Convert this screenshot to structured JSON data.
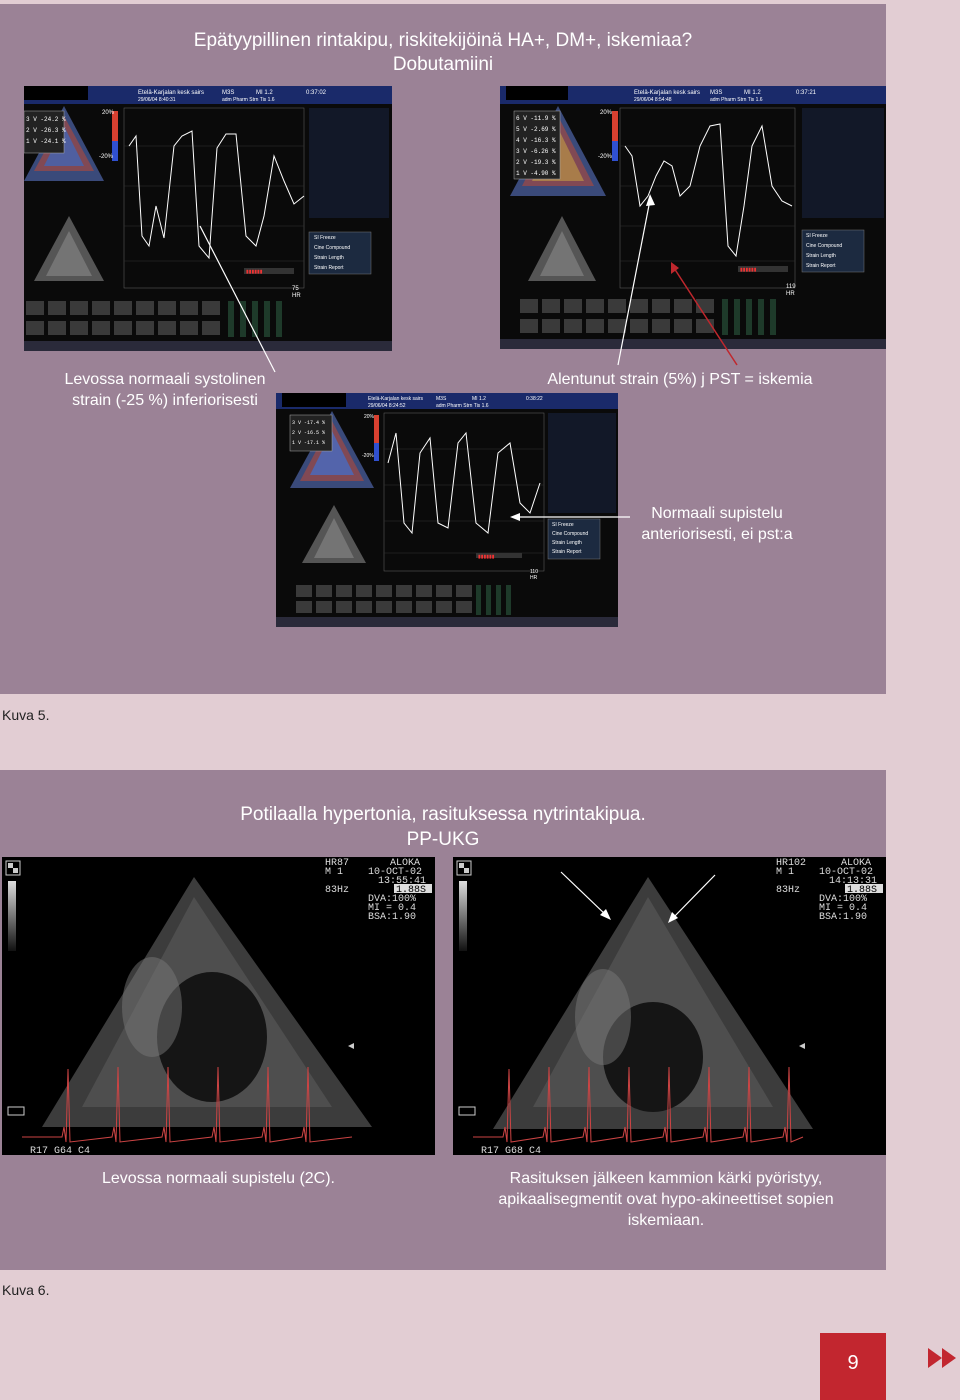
{
  "figure5": {
    "title_line1": "Epätyypillinen rintakipu, riskitekijöinä HA+, DM+, iskemiaa?",
    "title_line2": "Dobutamiini",
    "screen1": {
      "hospital": "Etelä-Karjalan kesk sairs",
      "date": "29/06/04 8:40:31",
      "app": "adm Pharm Strn Tis 1.6",
      "time": "0:37:02",
      "probe": "M3S",
      "mi": "MI 1.2",
      "plus_pct": "20%",
      "minus_pct": "-20%",
      "segment_values": [
        "3 V -24.2 %",
        "2 V -26.3 %",
        "1 V -24.1 %"
      ],
      "hr": "75",
      "hr_label": "HR",
      "menu": [
        "SI Freeze",
        "Cine Compound",
        "Strain Length",
        "Strain Report"
      ]
    },
    "screen2": {
      "hospital": "Etelä-Karjalan kesk sairs",
      "date": "29/06/04 8:54:48",
      "app": "adm Pharm Strn Tis 1.6",
      "time": "0:37:21",
      "probe": "M3S",
      "mi": "MI 1.2",
      "plus_pct": "20%",
      "minus_pct": "-20%",
      "segment_values": [
        "6 V -11.9 %",
        "5 V -2.69 %",
        "4 V -16.3 %",
        "3 V -6.26 %",
        "2 V -19.3 %",
        "1 V -4.90 %"
      ],
      "hr": "119",
      "hr_label": "HR",
      "menu": [
        "SI Freeze",
        "Cine Compound",
        "Strain Length",
        "Strain Report"
      ]
    },
    "screen3": {
      "hospital": "Etelä-Karjalan kesk sairs",
      "date": "29/06/04 8:24:52",
      "app": "adm Pharm Strn Tis 1.6",
      "time": "0:38:22",
      "probe": "M3S",
      "mi": "MI 1.2",
      "plus_pct": "20%",
      "minus_pct": "-20%",
      "segment_values": [
        "3 V -17.4 %",
        "2 V -16.5 %",
        "1 V -17.1 %"
      ],
      "hr": "110",
      "hr_label": "HR",
      "menu": [
        "SI Freeze",
        "Cine Compound",
        "Strain Length",
        "Strain Report"
      ]
    },
    "caption_left_line1": "Levossa normaali systolinen",
    "caption_left_line2": "strain (-25 %) inferiorisesti",
    "caption_right": "Alentunut strain (5%) j PST = iskemia",
    "caption_normal_line1": "Normaali supistelu",
    "caption_normal_line2": "anteriorisesti, ei pst:a",
    "label": "Kuva 5."
  },
  "figure6": {
    "title_line1": "Potilaalla hypertonia, rasituksessa nytrintakipua.",
    "title_line2": "PP-UKG",
    "left_image": {
      "hr": "HR87",
      "brand": "ALOKA",
      "mode": "M 1",
      "date": "10-OCT-02",
      "time": "13:55:41",
      "depth": "1.88S",
      "freq": "83Hz",
      "dva": "DVA:100%",
      "mi": "MI = 0.4",
      "bsa": "BSA:1.90",
      "footer": "R17 G64 C4"
    },
    "right_image": {
      "hr": "HR102",
      "brand": "ALOKA",
      "mode": "M 1",
      "date": "10-OCT-02",
      "time": "14:13:31",
      "depth": "1.88S",
      "freq": "83Hz",
      "dva": "DVA:100%",
      "mi": "MI = 0.4",
      "bsa": "BSA:1.90",
      "footer": "R17 G68 C4"
    },
    "caption_left": "Levossa normaali supistelu (2C).",
    "caption_right_line1": "Rasituksen jälkeen kammion kärki pyöristyy,",
    "caption_right_line2": "apikaalisegmentit ovat hypo-akineettiset sopien",
    "caption_right_line3": "iskemiaan.",
    "label": "Kuva 6."
  },
  "page_number": "9",
  "colors": {
    "panel": "#9b8296",
    "page_background": "#e2cdd3",
    "page_number_box": "#c2262f",
    "arrow_red": "#c0272d"
  },
  "icons": [
    "fast-forward-icon"
  ]
}
